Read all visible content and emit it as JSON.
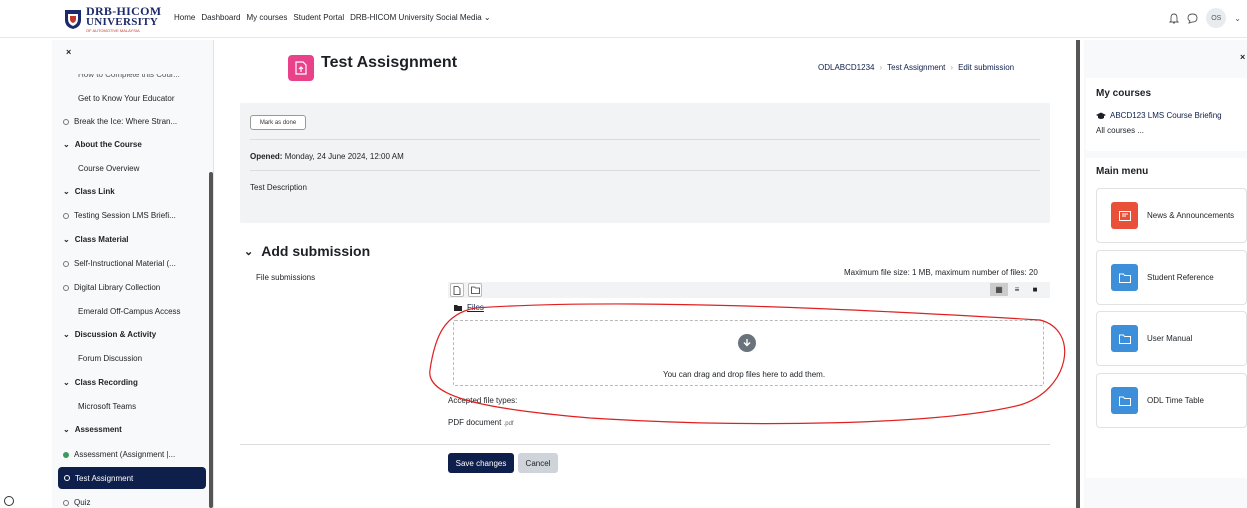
{
  "brand": {
    "line1": "DRB-HICOM",
    "line2": "UNIVERSITY",
    "line3": "OF AUTOMOTIVE MALAYSIA"
  },
  "nav": {
    "items": [
      "Home",
      "Dashboard",
      "My courses",
      "Student Portal",
      "DRB-HICOM University Social Media ⌄"
    ]
  },
  "user": {
    "initials": "OS"
  },
  "drawer": {
    "close": "×",
    "partial_item": "How to Complete this Cour...",
    "items": [
      {
        "label": "Get to Know Your Educator",
        "kind": "plain"
      },
      {
        "label": "Break the Ice: Where Stran...",
        "kind": "circle"
      },
      {
        "label": "About the Course",
        "kind": "section"
      },
      {
        "label": "Course Overview",
        "kind": "plain"
      },
      {
        "label": "Class Link",
        "kind": "section"
      },
      {
        "label": "Testing Session LMS Briefi...",
        "kind": "circle"
      },
      {
        "label": "Class Material",
        "kind": "section"
      },
      {
        "label": "Self-Instructional Material (...",
        "kind": "circle"
      },
      {
        "label": "Digital Library Collection",
        "kind": "circle"
      },
      {
        "label": "Emerald Off-Campus Access",
        "kind": "plain"
      },
      {
        "label": "Discussion & Activity",
        "kind": "section"
      },
      {
        "label": "Forum Discussion",
        "kind": "plain"
      },
      {
        "label": "Class Recording",
        "kind": "section"
      },
      {
        "label": "Microsoft Teams",
        "kind": "plain"
      },
      {
        "label": "Assessment",
        "kind": "section"
      },
      {
        "label": "Assessment (Assignment |...",
        "kind": "done"
      }
    ],
    "active": "Test Assignment",
    "last": "Quiz"
  },
  "page": {
    "title": "Test Assisgnment",
    "breadcrumbs": [
      "ODLABCD1234",
      "Test Assignment",
      "Edit submission"
    ],
    "mark_done": "Mark as done",
    "opened_label": "Opened:",
    "opened_value": "Monday, 24 June 2024, 12:00 AM",
    "description": "Test Description",
    "section_title": "Add submission",
    "file_label": "File submissions",
    "max_size": "Maximum file size: 1 MB, maximum number of files: 20",
    "files_folder": "Files",
    "drop_text": "You can drag and drop files here to add them.",
    "accepted_label": "Accepted file types:",
    "accepted_type": "PDF document",
    "accepted_ext": ".pdf",
    "save": "Save changes",
    "cancel": "Cancel"
  },
  "right": {
    "close": "×",
    "my_courses_title": "My courses",
    "course_link": "ABCD123 LMS Course Briefing",
    "all_courses": "All courses ...",
    "main_menu_title": "Main menu",
    "cards": [
      {
        "label": "News & Announcements",
        "color": "#e8503a"
      },
      {
        "label": "Student Reference",
        "color": "#3d8fd9"
      },
      {
        "label": "User Manual",
        "color": "#3d8fd9"
      },
      {
        "label": "ODL Time Table",
        "color": "#3d8fd9"
      }
    ]
  },
  "colors": {
    "primary": "#0f1f4b",
    "annotation": "#e02020",
    "assignment_tile": "#e9428b"
  }
}
